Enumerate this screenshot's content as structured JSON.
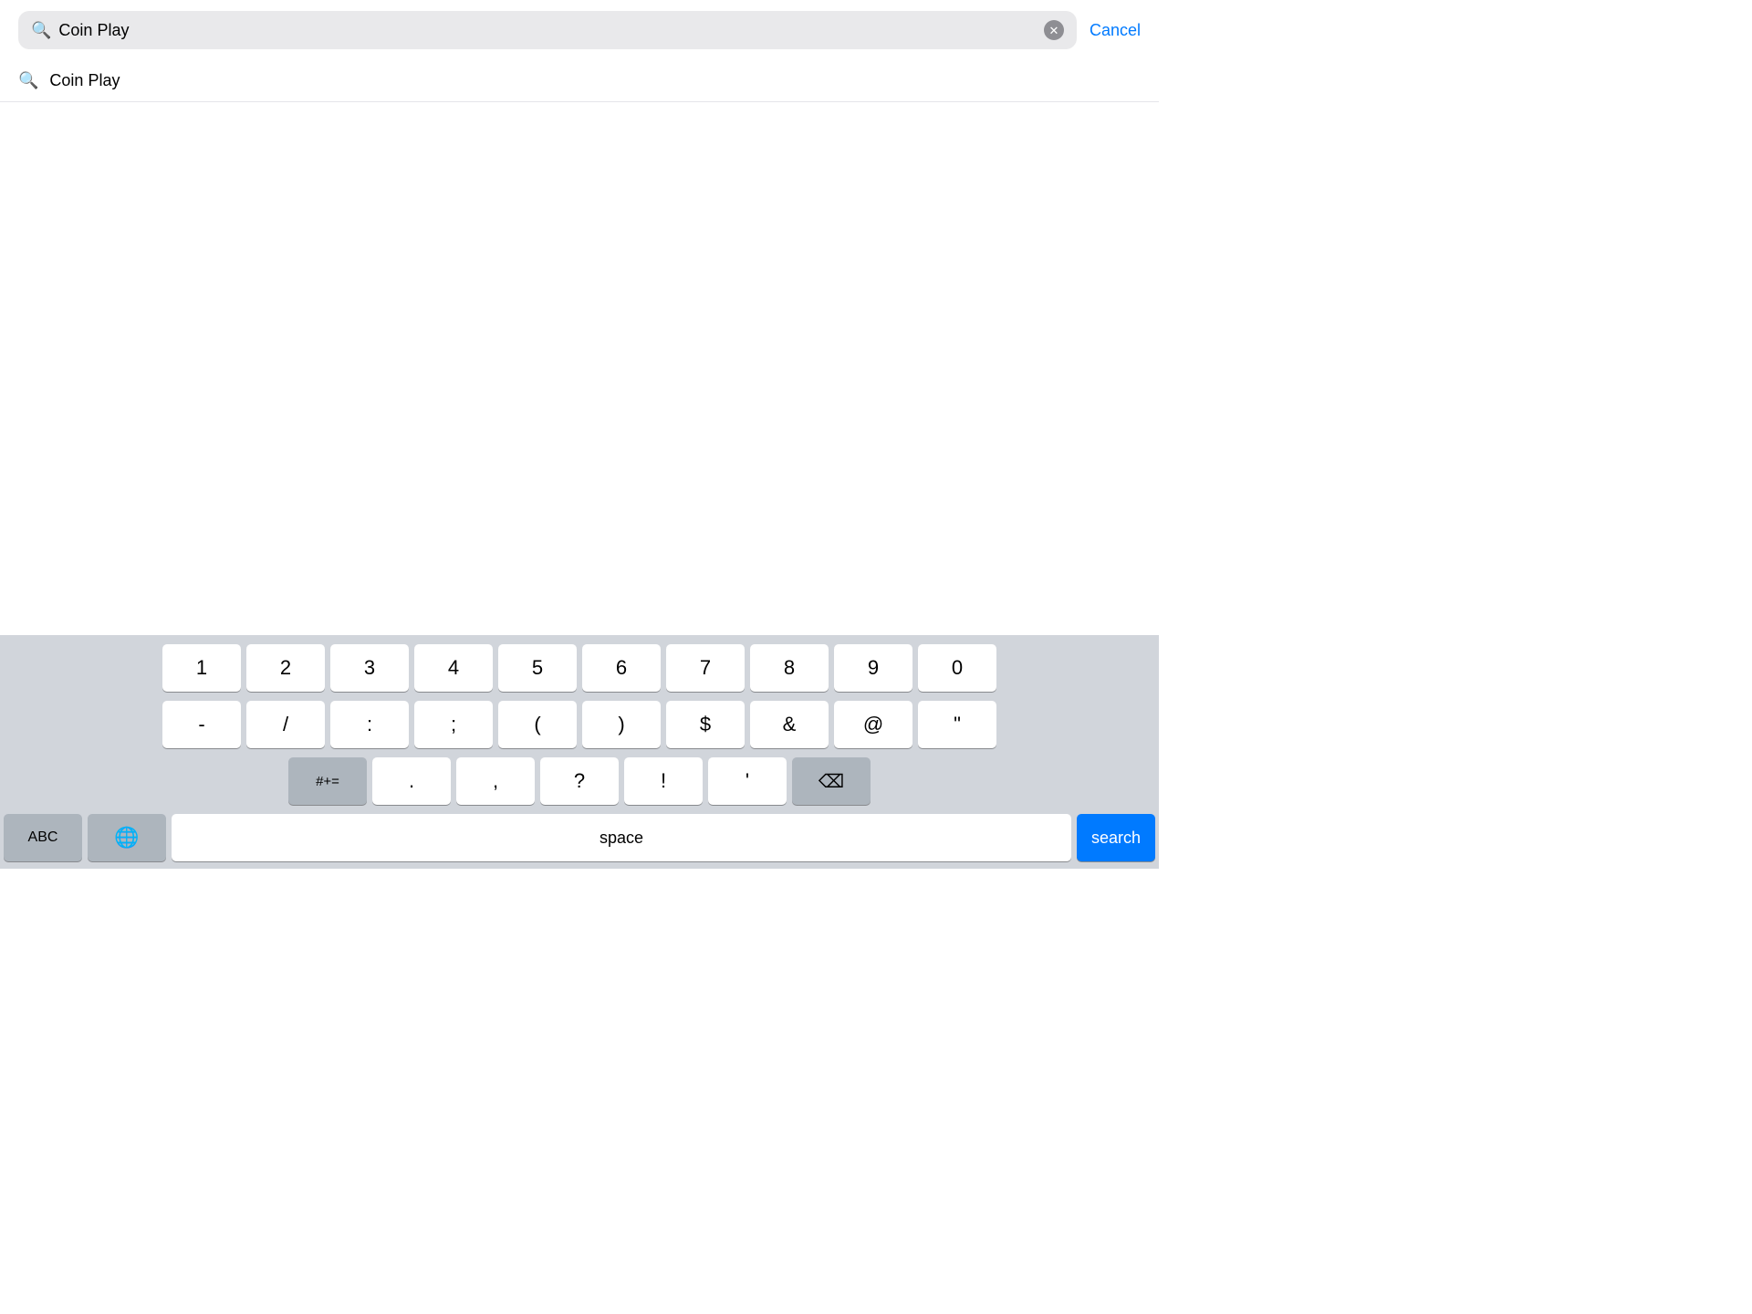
{
  "searchBar": {
    "searchIconLabel": "🔍",
    "inputValue": "Coin Play",
    "clearButtonLabel": "✕",
    "cancelButtonLabel": "Cancel"
  },
  "searchResult": {
    "iconLabel": "🔍",
    "text": "Coin Play"
  },
  "keyboard": {
    "row1": [
      "1",
      "2",
      "3",
      "4",
      "5",
      "6",
      "7",
      "8",
      "9",
      "0"
    ],
    "row2": [
      "-",
      "/",
      ":",
      ";",
      "(",
      ")",
      "$",
      "&",
      "@",
      "\""
    ],
    "row3Left": "#+=",
    "row3Keys": [
      ".",
      ",",
      "?",
      "!",
      "'"
    ],
    "deleteLabel": "⌫",
    "bottomLeft": "ABC",
    "globeLabel": "🌐",
    "spaceLabel": "space",
    "searchLabel": "search"
  }
}
